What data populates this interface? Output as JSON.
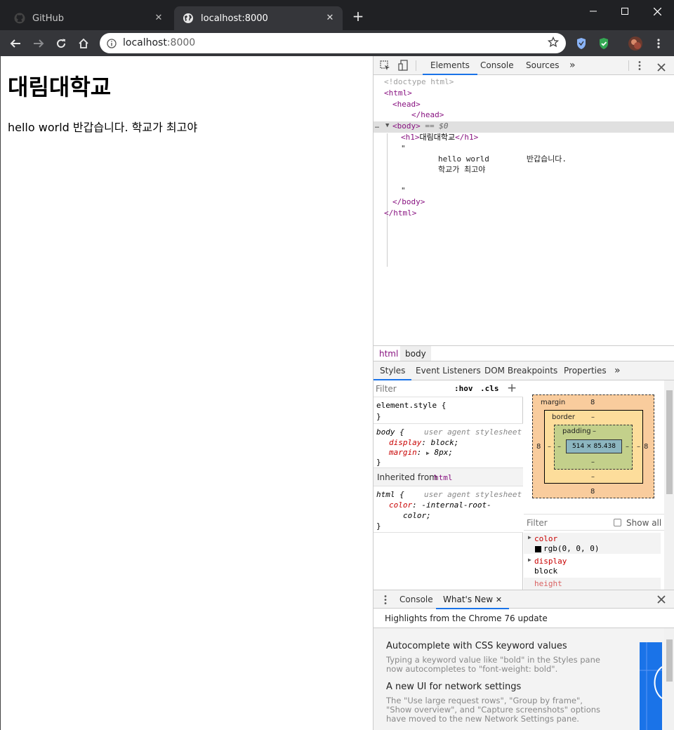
{
  "browser": {
    "tabs": [
      {
        "title": "GitHub",
        "icon": "github-icon",
        "active": false
      },
      {
        "title": "localhost:8000",
        "icon": "globe-icon",
        "active": true
      }
    ],
    "new_tab": "+",
    "window_controls": {
      "minimize": "—",
      "maximize": "☐",
      "close": "✕"
    },
    "address": {
      "host": "localhost",
      "port": ":8000"
    }
  },
  "page": {
    "heading": "대림대학교",
    "body_text": "hello world 반갑습니다. 학교가 최고야"
  },
  "devtools": {
    "main_tabs": [
      "Elements",
      "Console",
      "Sources"
    ],
    "more": "»",
    "dom": {
      "doctype": "<!doctype html>",
      "html_open": "<html>",
      "head_open": "<head>",
      "head_close": "</head>",
      "body_open": "<body>",
      "body_eq": " == $0",
      "h1_open": "<h1>",
      "h1_text": "대림대학교",
      "h1_close": "</h1>",
      "quote_open": "\"",
      "text_line1": "hello world        반갑습니다.",
      "text_line2": "학교가 최고야",
      "quote_close": "\"",
      "body_close": "</body>",
      "html_close": "</html>",
      "ellipsis": "…"
    },
    "breadcrumbs": [
      "html",
      "body"
    ],
    "sub_tabs": [
      "Styles",
      "Event Listeners",
      "DOM Breakpoints",
      "Properties"
    ],
    "styles": {
      "filter_placeholder": "Filter",
      "hov": ":hov",
      "cls": ".cls",
      "add": "+",
      "element_style": "element.style {",
      "close_brace": "}",
      "body_selector": "body {",
      "ua_label": "user agent stylesheet",
      "display_prop": "display",
      "display_val": "block;",
      "margin_prop": "margin",
      "margin_val": "8px;",
      "inherited_label": "Inherited from",
      "inherited_from": "html",
      "html_selector": "html {",
      "color_prop": "color",
      "color_val_1": "-internal-root-",
      "color_val_2": "color;"
    },
    "box_model": {
      "margin_label": "margin",
      "margin_top": "8",
      "margin_bottom": "8",
      "margin_left": "8",
      "margin_right": "8",
      "border_label": "border",
      "border_val": "–",
      "padding_label": "padding",
      "padding_val": "–",
      "content": "514 × 85.438",
      "dash": "–"
    },
    "computed": {
      "filter_placeholder": "Filter",
      "show_all": "Show all",
      "items": [
        {
          "prop": "color",
          "value": "rgb(0, 0, 0)"
        },
        {
          "prop": "display",
          "value": "block"
        },
        {
          "prop": "height",
          "value": ""
        }
      ]
    },
    "drawer": {
      "tabs": [
        "Console",
        "What's New"
      ],
      "highlights": "Highlights from the Chrome 76 update",
      "items": [
        {
          "title": "Autocomplete with CSS keyword values",
          "desc_1": "Typing a keyword value like \"bold\" in the Styles pane",
          "desc_2": "now autocompletes to \"font-weight: bold\"."
        },
        {
          "title": "A new UI for network settings",
          "desc_1": "The \"Use large request rows\", \"Group by frame\",",
          "desc_2": "\"Show overview\", and \"Capture screenshots\" options",
          "desc_3": "have moved to the new Network Settings pane."
        }
      ]
    }
  },
  "colors": {
    "titlebar": "#202124",
    "toolbar": "#35363a",
    "accent": "#1a73e8",
    "tag": "#881280",
    "css_prop": "#c80000"
  }
}
